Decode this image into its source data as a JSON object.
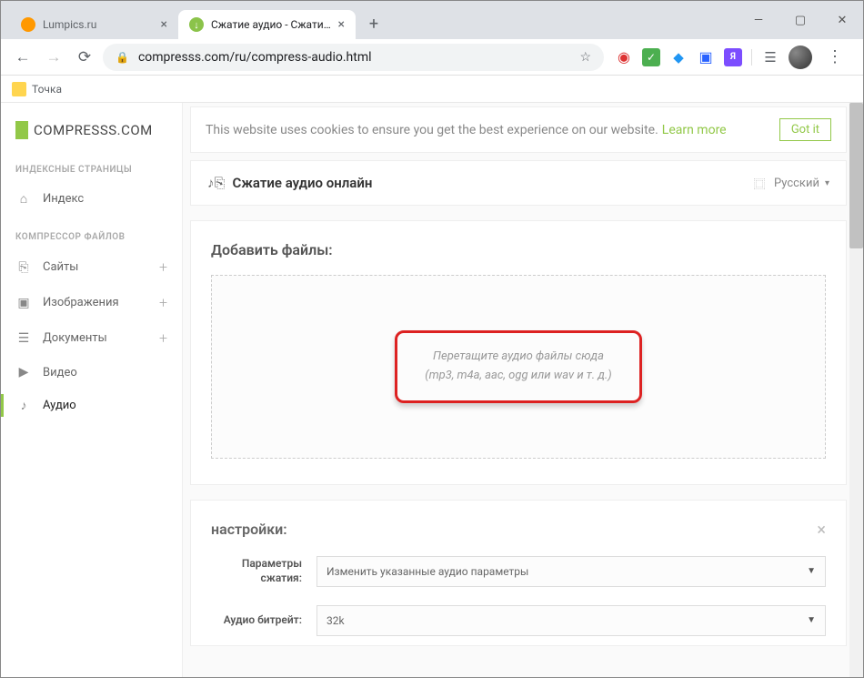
{
  "browser": {
    "tabs": [
      {
        "title": "Lumpics.ru",
        "active": false
      },
      {
        "title": "Сжатие аудио - Сжатие файлов",
        "active": true
      }
    ],
    "url": "compresss.com/ru/compress-audio.html",
    "bookmark": "Точка"
  },
  "brand": "COMPRESSS.COM",
  "sidebar": {
    "section1": "ИНДЕКСНЫЕ СТРАНИЦЫ",
    "index": "Индекс",
    "section2": "КОМПРЕССОР ФАЙЛОВ",
    "items": {
      "sites": "Сайты",
      "images": "Изображения",
      "docs": "Документы",
      "video": "Видео",
      "audio": "Аудио"
    }
  },
  "cookie": {
    "text": "This website uses cookies to ensure you get the best experience on our website.",
    "learn": "Learn more",
    "button": "Got it"
  },
  "page_title": "Сжатие аудио онлайн",
  "language": "Русский",
  "add_files": {
    "heading": "Добавить файлы:",
    "line1": "Перетащите аудио файлы сюда",
    "line2": "(mp3, m4a, aac, ogg или wav и т. д.)"
  },
  "settings": {
    "heading": "настройки:",
    "compress_label": "Параметры сжатия:",
    "compress_value": "Изменить указанные аудио параметры",
    "bitrate_label": "Аудио битрейт:",
    "bitrate_value": "32k"
  }
}
